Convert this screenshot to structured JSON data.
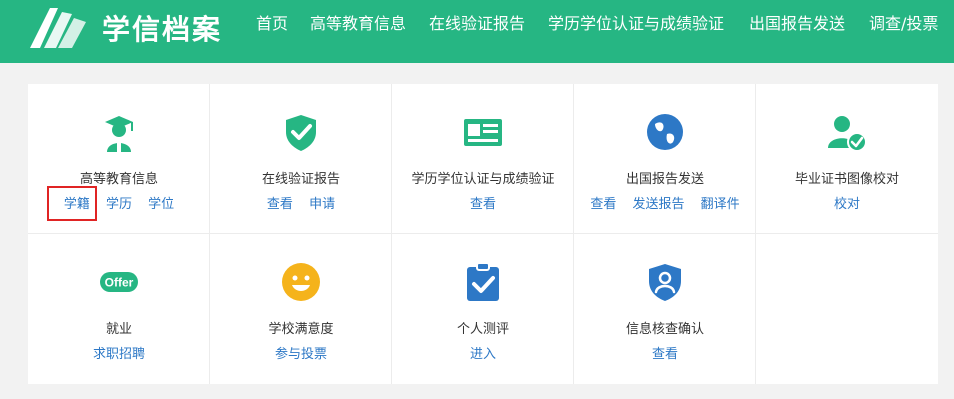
{
  "header": {
    "logo_text": "学信档案",
    "nav": [
      "首页",
      "高等教育信息",
      "在线验证报告",
      "学历学位认证与成绩验证",
      "出国报告发送",
      "调查/投票"
    ]
  },
  "colors": {
    "brand": "#26b683",
    "link": "#2d78c6",
    "highlight": "#e02424"
  },
  "cards": [
    {
      "title": "高等教育信息",
      "icon": "graduate-icon",
      "links": [
        "学籍",
        "学历",
        "学位"
      ]
    },
    {
      "title": "在线验证报告",
      "icon": "shield-check-icon",
      "links": [
        "查看",
        "申请"
      ]
    },
    {
      "title": "学历学位认证与成绩验证",
      "icon": "id-card-icon",
      "links": [
        "查看"
      ]
    },
    {
      "title": "出国报告发送",
      "icon": "globe-icon",
      "links": [
        "查看",
        "发送报告",
        "翻译件"
      ]
    },
    {
      "title": "毕业证书图像校对",
      "icon": "user-check-icon",
      "links": [
        "校对"
      ]
    },
    {
      "title": "就业",
      "icon": "offer-icon",
      "icon_text": "Offer",
      "links": [
        "求职招聘"
      ]
    },
    {
      "title": "学校满意度",
      "icon": "smiley-icon",
      "links": [
        "参与投票"
      ]
    },
    {
      "title": "个人测评",
      "icon": "clipboard-check-icon",
      "links": [
        "进入"
      ]
    },
    {
      "title": "信息核查确认",
      "icon": "user-shield-icon",
      "links": [
        "查看"
      ]
    }
  ]
}
